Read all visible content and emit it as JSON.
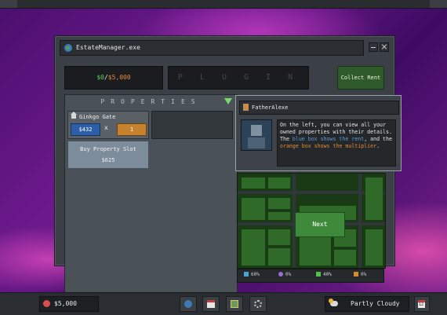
{
  "window": {
    "title": "EstateManager.exe"
  },
  "header": {
    "money_current": "$0",
    "money_separator": "/",
    "money_goal": "$5,000",
    "plugins_label": "P L U G I N S",
    "collect_rent_label": "Collect Rent"
  },
  "properties": {
    "title": "PROPERTIES",
    "cards": [
      {
        "name": "Ginkgo Gate",
        "rent": "$432",
        "times": "x",
        "multiplier": "1"
      }
    ],
    "buy_slot": {
      "label": "Buy Property Slot",
      "price": "$625"
    }
  },
  "dialog": {
    "speaker": "FatherAlexe",
    "text_1": "On the left, you can view all your owned properties with their details. The ",
    "text_blue": "blue box shows the rent",
    "text_2": ", and the ",
    "text_orange": "orange box shows the multiplier",
    "text_3": "."
  },
  "map": {
    "next_label": "Next"
  },
  "stats": [
    {
      "icon": "house-icon",
      "value": "60%",
      "color": "#4aa3d8"
    },
    {
      "icon": "happiness-icon",
      "value": "0%",
      "color": "#9b6bd6"
    },
    {
      "icon": "money-icon",
      "value": "40%",
      "color": "#4ec44e"
    },
    {
      "icon": "briefcase-icon",
      "value": "0%",
      "color": "#d98a2e"
    }
  ],
  "taskbar": {
    "cash": "$5,000",
    "weather": "Partly Cloudy",
    "calendar_day": "12"
  },
  "colors": {
    "accent_green": "#3e8a3a",
    "rent_blue": "#2d5fa8",
    "multiplier_orange": "#c6822d"
  }
}
